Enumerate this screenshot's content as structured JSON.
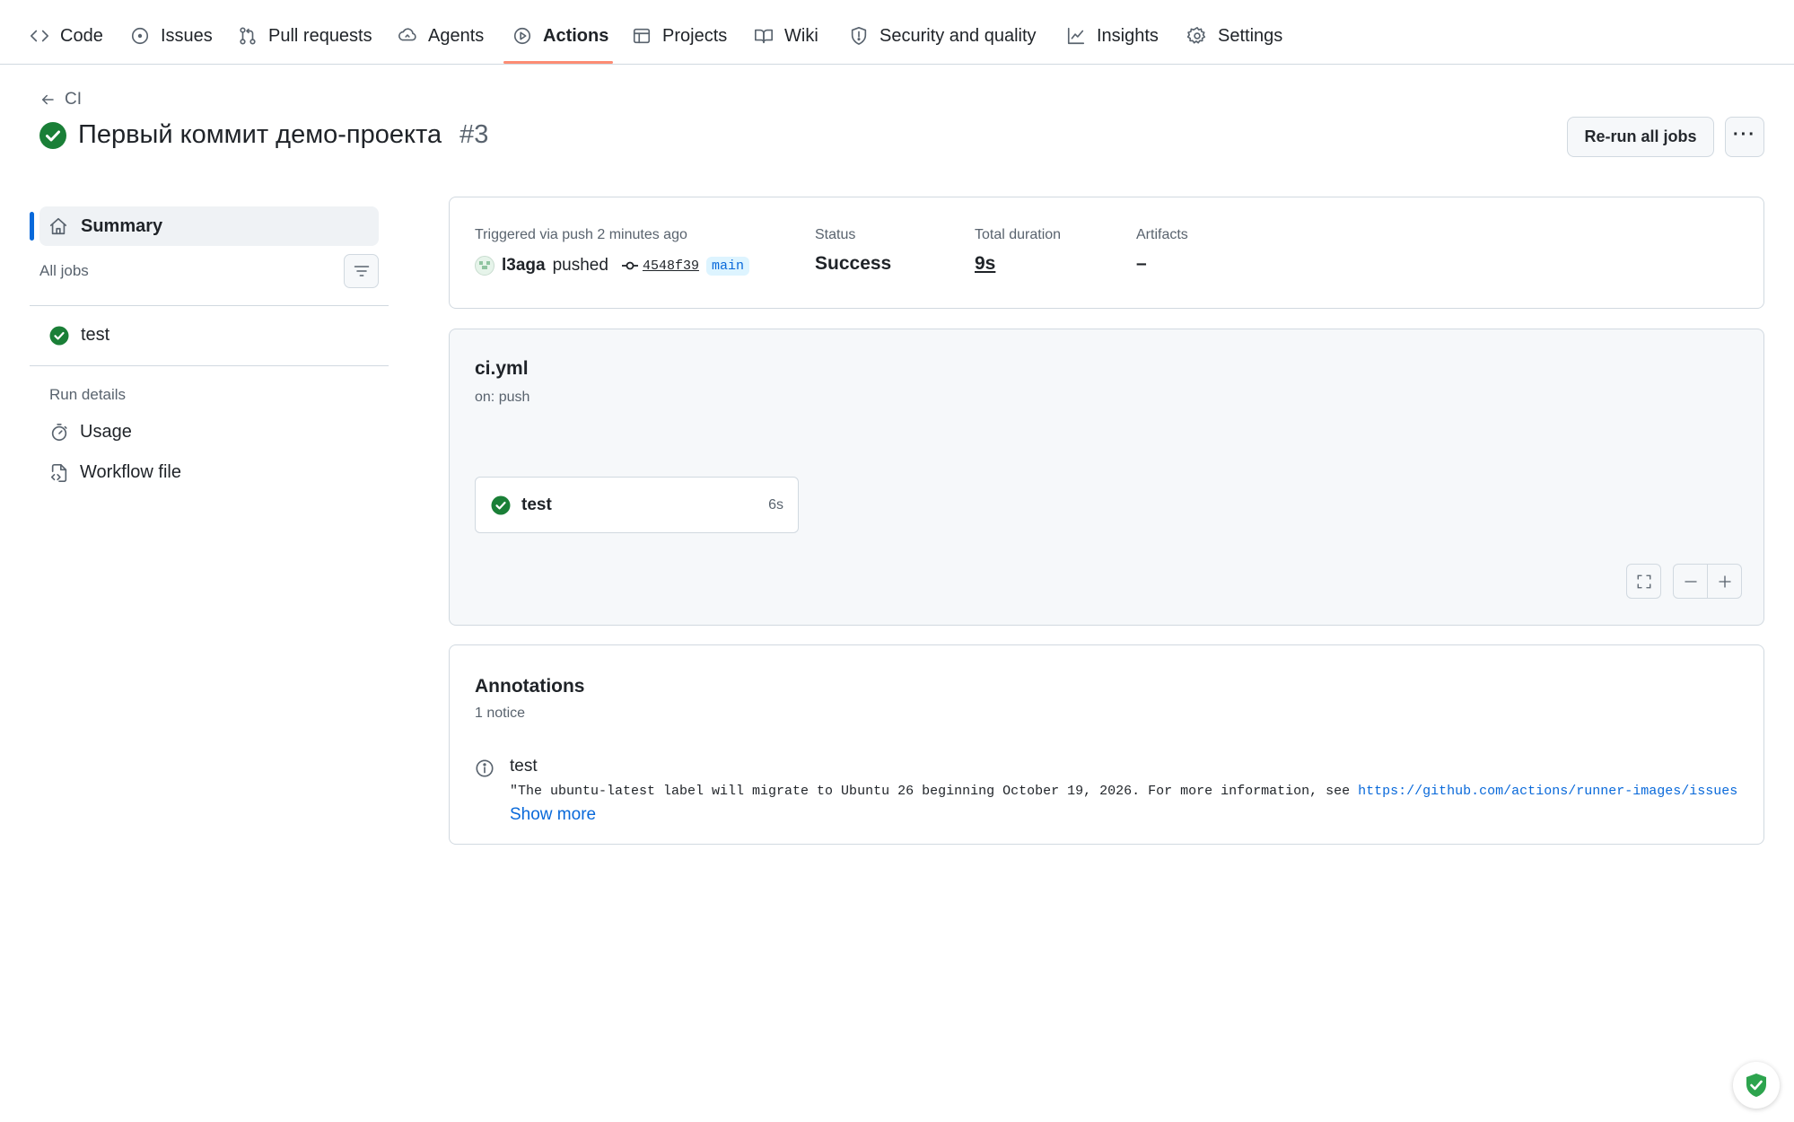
{
  "nav": {
    "items": [
      {
        "label": "Code",
        "icon": "code-icon"
      },
      {
        "label": "Issues",
        "icon": "issue-icon"
      },
      {
        "label": "Pull requests",
        "icon": "pull-request-icon"
      },
      {
        "label": "Agents",
        "icon": "agents-icon"
      },
      {
        "label": "Actions",
        "icon": "play-icon",
        "active": true
      },
      {
        "label": "Projects",
        "icon": "table-icon"
      },
      {
        "label": "Wiki",
        "icon": "book-icon"
      },
      {
        "label": "Security and quality",
        "icon": "shield-icon"
      },
      {
        "label": "Insights",
        "icon": "graph-icon"
      },
      {
        "label": "Settings",
        "icon": "gear-icon"
      }
    ]
  },
  "header": {
    "back_label": "CI",
    "title": "Первый коммит демо-проекта",
    "run_number": "#3",
    "rerun_label": "Re-run all jobs",
    "more_label": "···"
  },
  "sidebar": {
    "summary_label": "Summary",
    "all_jobs_label": "All jobs",
    "jobs": [
      {
        "name": "test",
        "status": "success"
      }
    ],
    "run_details_label": "Run details",
    "links": [
      {
        "label": "Usage",
        "icon": "stopwatch-icon"
      },
      {
        "label": "Workflow file",
        "icon": "file-code-icon"
      }
    ]
  },
  "summary": {
    "trigger_label": "Triggered via push 2 minutes ago",
    "actor": "l3aga",
    "action": "pushed",
    "commit": "4548f39",
    "branch": "main",
    "status_label": "Status",
    "status_value": "Success",
    "duration_label": "Total duration",
    "duration_value": "9s",
    "artifacts_label": "Artifacts",
    "artifacts_value": "–"
  },
  "workflow": {
    "file": "ci.yml",
    "on": "on: push",
    "job": {
      "name": "test",
      "duration": "6s"
    }
  },
  "annotations": {
    "title": "Annotations",
    "count": "1 notice",
    "items": [
      {
        "job": "test",
        "message_prefix": "\"The ubuntu-latest label will migrate to Ubuntu 26 beginning October 19, 2026. For more information, see ",
        "link": "https://github.com/actions/runner-images/issues",
        "show_more": "Show more"
      }
    ]
  },
  "colors": {
    "success": "#1a7f37",
    "accent": "#0969da",
    "nav_underline": "#fd8c73"
  }
}
